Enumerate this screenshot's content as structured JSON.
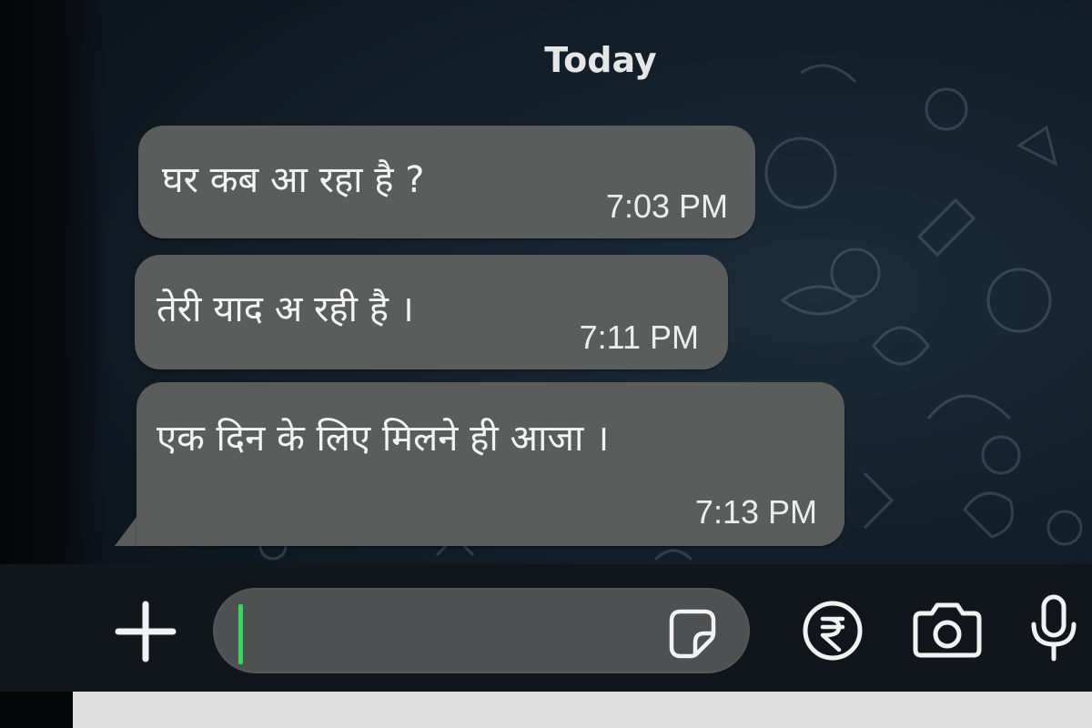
{
  "chat": {
    "date_label": "Today",
    "messages": [
      {
        "text": "घर  कब  आ रहा है ?",
        "time": "7:03 PM"
      },
      {
        "text": "तेरी याद अ रही है ।",
        "time": "7:11 PM"
      },
      {
        "text": "एक दिन  के लिए  मिलने ही आजा ।",
        "time": "7:13 PM"
      }
    ],
    "bubble_color": "#5b5c5c"
  },
  "composer": {
    "value": "",
    "placeholder": "",
    "cursor_color": "#39d957",
    "icons": {
      "attach": "plus-icon",
      "sticker": "sticker-icon",
      "payment": "rupee-icon",
      "camera": "camera-icon",
      "voice": "microphone-icon"
    }
  }
}
